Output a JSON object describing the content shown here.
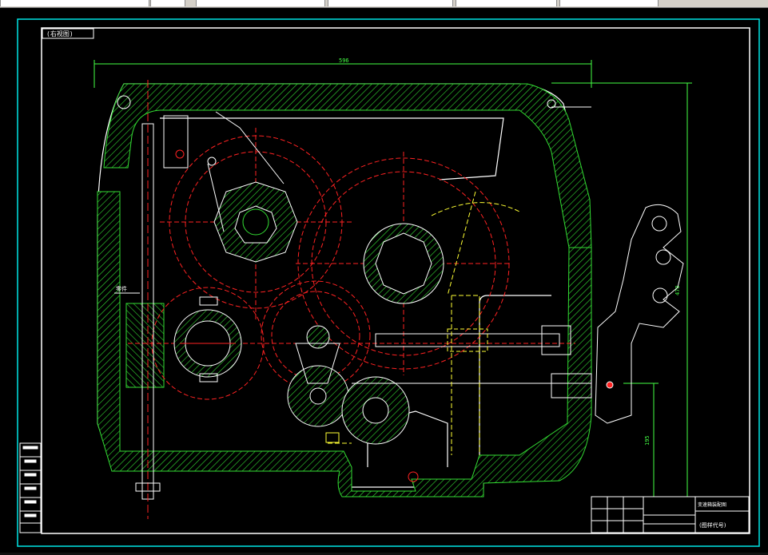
{
  "colors": {
    "background": "#000000",
    "frame": "#00e5e5",
    "outline": "#ffffff",
    "section": "#33dd33",
    "gear": "#ff2222",
    "hidden": "#ffff33",
    "dimension": "#44ff44"
  },
  "drawing": {
    "view_label": "(右视图)",
    "dimension_width": "596",
    "dimension_height": "470",
    "dimension_lower": "195",
    "side_note": "零件",
    "title_block": {
      "name": "变速箱装配图",
      "drawing_no": "(图样代号)"
    }
  }
}
